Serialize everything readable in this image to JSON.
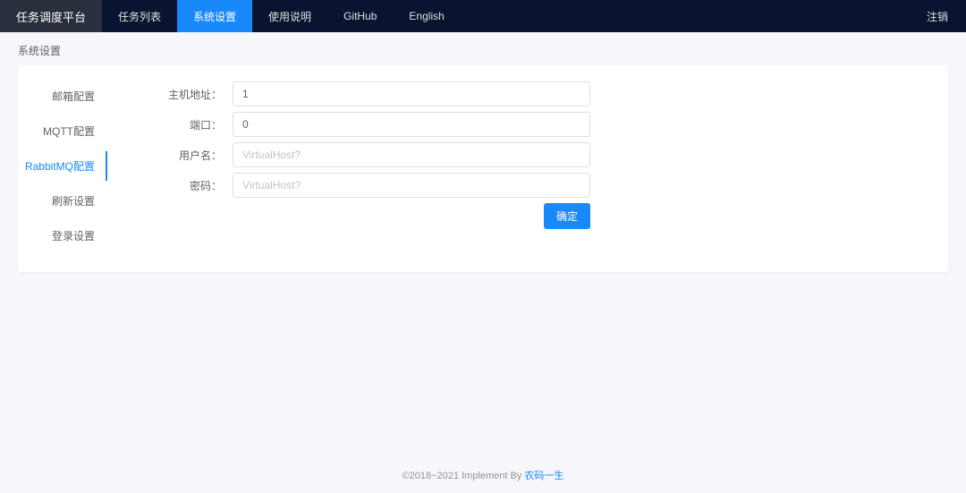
{
  "nav": {
    "brand": "任务调度平台",
    "items": [
      "任务列表",
      "系统设置",
      "使用说明",
      "GitHub",
      "English"
    ],
    "logout": "注销"
  },
  "breadcrumb": "系统设置",
  "sidebar": {
    "items": [
      "邮箱配置",
      "MQTT配置",
      "RabbitMQ配置",
      "刷新设置",
      "登录设置"
    ]
  },
  "form": {
    "host_label": "主机地址：",
    "host_value": "1",
    "port_label": "端口：",
    "port_value": "0",
    "user_label": "用户名：",
    "user_placeholder": "VirtualHost?",
    "pass_label": "密码：",
    "pass_placeholder": "VirtualHost?",
    "submit": "确定"
  },
  "footer": {
    "text": "©2018~2021 Implement By ",
    "link": "农码一生"
  }
}
